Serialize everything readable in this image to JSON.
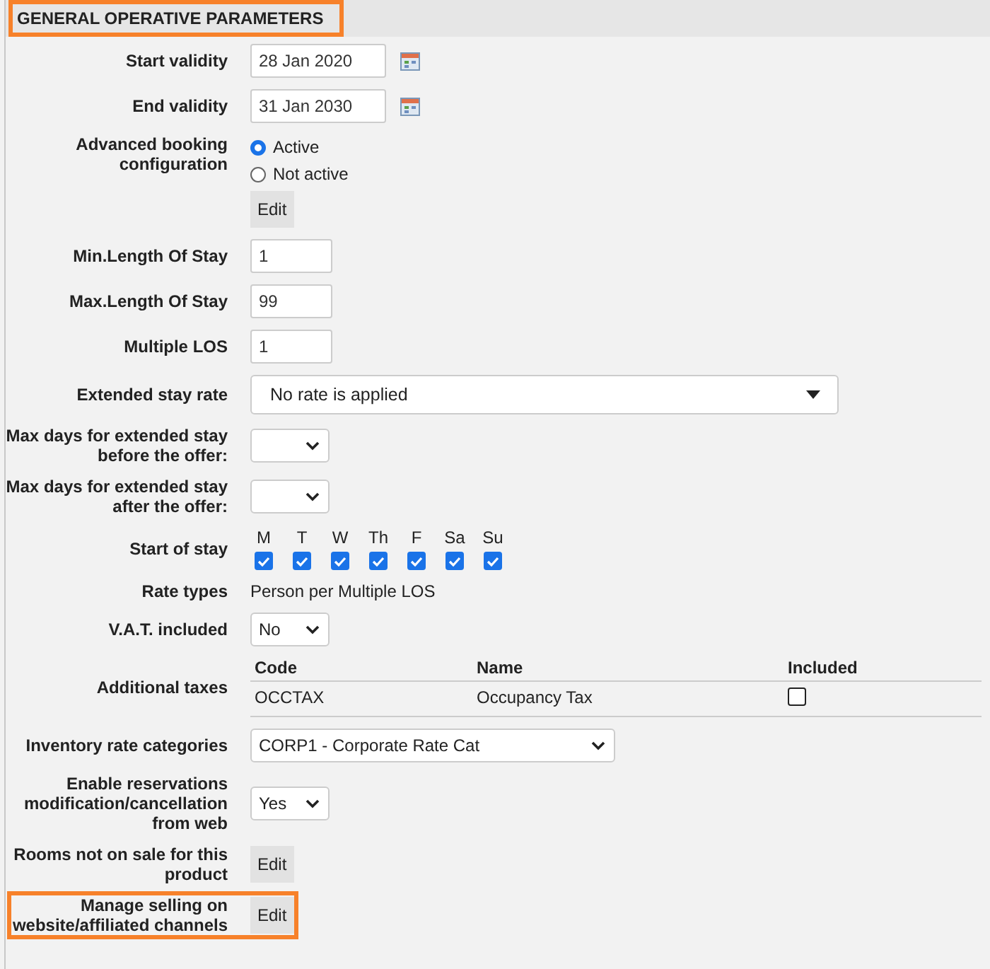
{
  "header": {
    "title": "GENERAL OPERATIVE PARAMETERS",
    "highlighted": true
  },
  "rows": [
    {
      "kind": "date",
      "label": "Start validity",
      "value": "28 Jan 2020"
    },
    {
      "kind": "date",
      "label": "End validity",
      "value": "31 Jan 2030"
    },
    {
      "kind": "radio",
      "label": "Advanced booking configuration",
      "options": [
        {
          "label": "Active",
          "selected": true
        },
        {
          "label": "Not active",
          "selected": false
        }
      ],
      "button": "Edit"
    },
    {
      "kind": "number",
      "label": "Min.Length Of Stay",
      "value": "1"
    },
    {
      "kind": "number",
      "label": "Max.Length Of Stay",
      "value": "99"
    },
    {
      "kind": "number",
      "label": "Multiple LOS",
      "value": "1"
    },
    {
      "kind": "combobox",
      "label": "Extended stay rate",
      "value": "No rate is applied"
    },
    {
      "kind": "select",
      "label": "Max days for extended stay before the offer:"
    },
    {
      "kind": "select",
      "label": "Max days for extended stay after the offer:"
    },
    {
      "kind": "days",
      "label": "Start of stay",
      "days": [
        {
          "label": "M",
          "checked": true
        },
        {
          "label": "T",
          "checked": true
        },
        {
          "label": "W",
          "checked": true
        },
        {
          "label": "Th",
          "checked": true
        },
        {
          "label": "F",
          "checked": true
        },
        {
          "label": "Sa",
          "checked": true
        },
        {
          "label": "Su",
          "checked": true
        }
      ]
    },
    {
      "kind": "text",
      "label": "Rate types",
      "value": "Person per Multiple LOS"
    },
    {
      "kind": "select",
      "label": "V.A.T. included",
      "value": "No"
    },
    {
      "kind": "taxes",
      "label": "Additional taxes",
      "columns": [
        "Code",
        "Name",
        "Included"
      ],
      "items": [
        {
          "code": "OCCTAX",
          "name": "Occupancy Tax",
          "included": false
        }
      ]
    },
    {
      "kind": "catalog",
      "label": "Inventory rate categories",
      "value": "CORP1 - Corporate Rate Cat"
    },
    {
      "kind": "select",
      "label": "Enable reservations modification/cancellation from web",
      "value": "Yes"
    },
    {
      "kind": "button",
      "label": "Rooms not on sale for this product",
      "button": "Edit",
      "highlighted": false
    },
    {
      "kind": "button",
      "label": "Manage selling on website/affiliated channels",
      "button": "Edit",
      "highlighted": true
    }
  ]
}
